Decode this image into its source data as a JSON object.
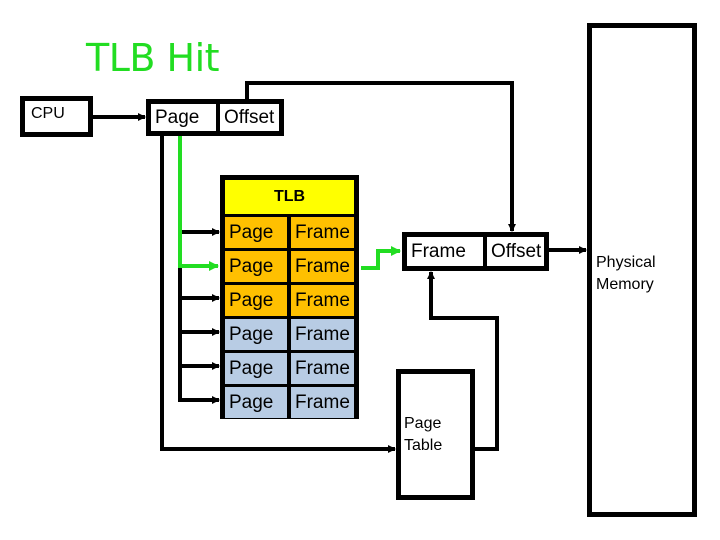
{
  "title": "TLB Hit",
  "cpu": {
    "label": "CPU"
  },
  "virtual_address": {
    "page_label": "Page",
    "offset_label": "Offset"
  },
  "tlb": {
    "header": "TLB",
    "rows": [
      {
        "page": "Page",
        "frame": "Frame",
        "state": "cached"
      },
      {
        "page": "Page",
        "frame": "Frame",
        "state": "cached-hit"
      },
      {
        "page": "Page",
        "frame": "Frame",
        "state": "cached"
      },
      {
        "page": "Page",
        "frame": "Frame",
        "state": "empty"
      },
      {
        "page": "Page",
        "frame": "Frame",
        "state": "empty"
      },
      {
        "page": "Page",
        "frame": "Frame",
        "state": "empty"
      }
    ],
    "hit_row_index": 1
  },
  "physical_address": {
    "frame_label": "Frame",
    "offset_label": "Offset"
  },
  "page_table": {
    "line1": "Page",
    "line2": "Table"
  },
  "physical_memory": {
    "line1": "Physical",
    "line2": "Memory"
  },
  "colors": {
    "hit_path": "#22dd22",
    "tlb_header": "#ffff00",
    "tlb_cached_rows": "#ffc000",
    "tlb_empty_rows": "#b8cce4",
    "wire": "#000000"
  }
}
